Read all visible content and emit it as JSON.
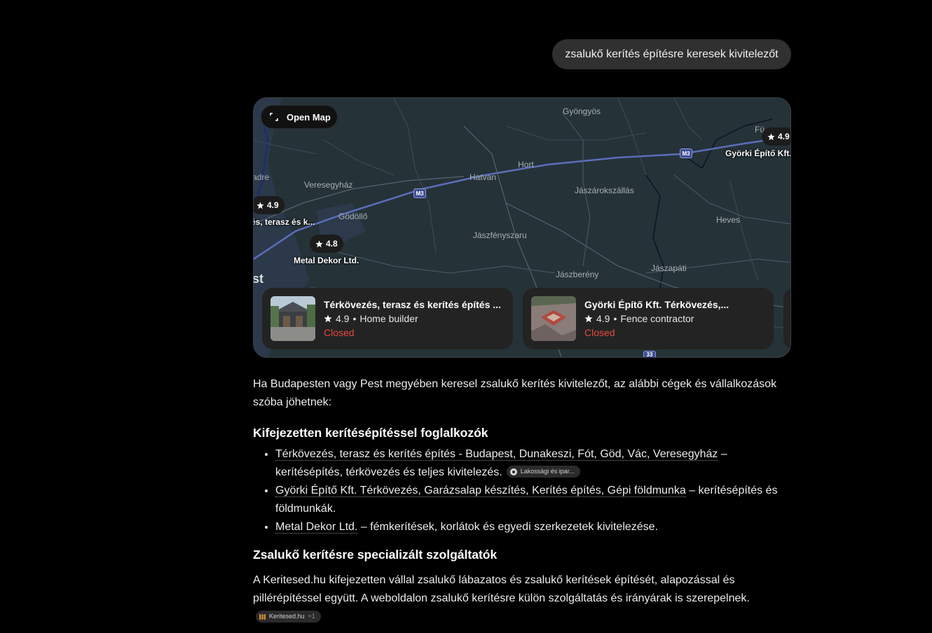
{
  "user_message": "zsalukő kerítés építésre keresek kivitelezőt",
  "map": {
    "open_map_label": "Open Map",
    "places": [
      {
        "name": "Gyöngyös"
      },
      {
        "name": "Hort"
      },
      {
        "name": "Hatvan"
      },
      {
        "name": "Veresegyház"
      },
      {
        "name": "Jászárokszállás"
      },
      {
        "name": "Gödöllő"
      },
      {
        "name": "Heves"
      },
      {
        "name": "Jászfényszaru"
      },
      {
        "name": "Jászberény"
      },
      {
        "name": "Jászapáti"
      },
      {
        "name": "Fü..."
      },
      {
        "name": "adre"
      },
      {
        "name": "st"
      }
    ],
    "road_shields": [
      "M3",
      "M3",
      "33"
    ],
    "pins": [
      {
        "rating": "4.9",
        "label": "Györki Építő Kft."
      },
      {
        "rating": "4.9",
        "label": "és, terasz és k..."
      },
      {
        "rating": "4.8",
        "label": "Metal Dekor Ltd."
      }
    ],
    "cards": [
      {
        "title": "Térkövezés, terasz és kerítés építés ...",
        "rating": "4.9",
        "category": "Home builder",
        "status": "Closed"
      },
      {
        "title": "Györki Építő Kft. Térkövezés,...",
        "rating": "4.9",
        "category": "Fence contractor",
        "status": "Closed"
      }
    ],
    "colors": {
      "background": "#253238",
      "closed": "#e5483d",
      "shield": "#3f4f93"
    }
  },
  "answer": {
    "intro": "Ha Budapesten vagy Pest megyében keresel zsalukő kerítés kivitelezőt, az alábbi cégek és vállalkozások szóba jöhetnek:",
    "section1_title": "Kifejezetten kerítésépítéssel foglalkozók",
    "items": [
      {
        "link": "Térkövezés, terasz és kerítés építés - Budapest, Dunakeszi, Fót, Göd, Vác, Veresegyház",
        "desc": " – kerítésépítés, térkövezés és teljes kivitelezés.",
        "chip": "Lakossági és ipar..."
      },
      {
        "link": "Györki Építő Kft. Térkövezés, Garázsalap készítés, Kerítés építés, Gépi földmunka",
        "desc": " – kerítésépítés és földmunkák."
      },
      {
        "link": "Metal Dekor Ltd.",
        "desc": " – fémkerítések, korlátok és egyedi szerkezetek kivitelezése."
      }
    ],
    "section2_title": "Zsalukő kerítésre specializált szolgáltatók",
    "para2": "A Keritesed.hu kifejezetten vállal zsalukő lábazatos és zsalukő kerítések építését, alapozással és pillérépítéssel együtt. A weboldalon zsalukő kerítésre külön szolgáltatás és irányárak is szerepelnek.",
    "source_chip": {
      "label": "Keritesed.hu",
      "extra": "+1"
    }
  }
}
